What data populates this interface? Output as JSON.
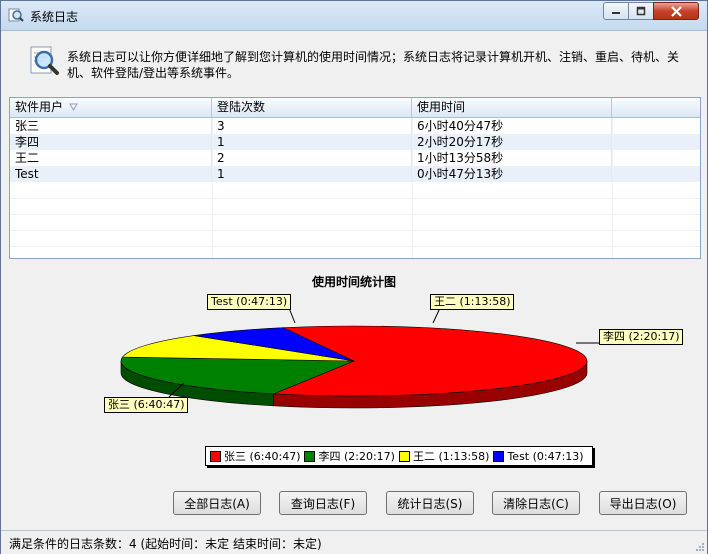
{
  "window": {
    "title": "系统日志"
  },
  "description": "系统日志可以让你方便详细地了解到您计算机的使用时间情况；系统日志将记录计算机开机、注销、重启、待机、关机、软件登陆/登出等系统事件。",
  "table": {
    "columns": [
      "软件用户",
      "登陆次数",
      "使用时间"
    ],
    "rows": [
      {
        "user": "张三",
        "count": "3",
        "time": "6小时40分47秒"
      },
      {
        "user": "李四",
        "count": "1",
        "time": "2小时20分17秒"
      },
      {
        "user": "王二",
        "count": "2",
        "time": "1小时13分58秒"
      },
      {
        "user": "Test",
        "count": "1",
        "time": "0小时47分13秒"
      }
    ]
  },
  "chart_data": {
    "type": "pie",
    "title": "使用时间统计图",
    "slices": [
      {
        "name": "张三",
        "label": "张三 (6:40:47)",
        "value": 24047,
        "color": "#ff0000"
      },
      {
        "name": "李四",
        "label": "李四 (2:20:17)",
        "value": 8417,
        "color": "#008000"
      },
      {
        "name": "王二",
        "label": "王二 (1:13:58)",
        "value": 4438,
        "color": "#ffff00"
      },
      {
        "name": "Test",
        "label": "Test (0:47:13)",
        "value": 2833,
        "color": "#0000ff"
      }
    ],
    "legend_position": "bottom"
  },
  "buttons": {
    "all_logs": "全部日志(A)",
    "query_logs": "查询日志(F)",
    "stats_logs": "统计日志(S)",
    "clear_logs": "清除日志(C)",
    "export_logs": "导出日志(O)"
  },
  "status": {
    "text": "满足条件的日志条数：4   (起始时间：未定  结束时间：未定)"
  }
}
